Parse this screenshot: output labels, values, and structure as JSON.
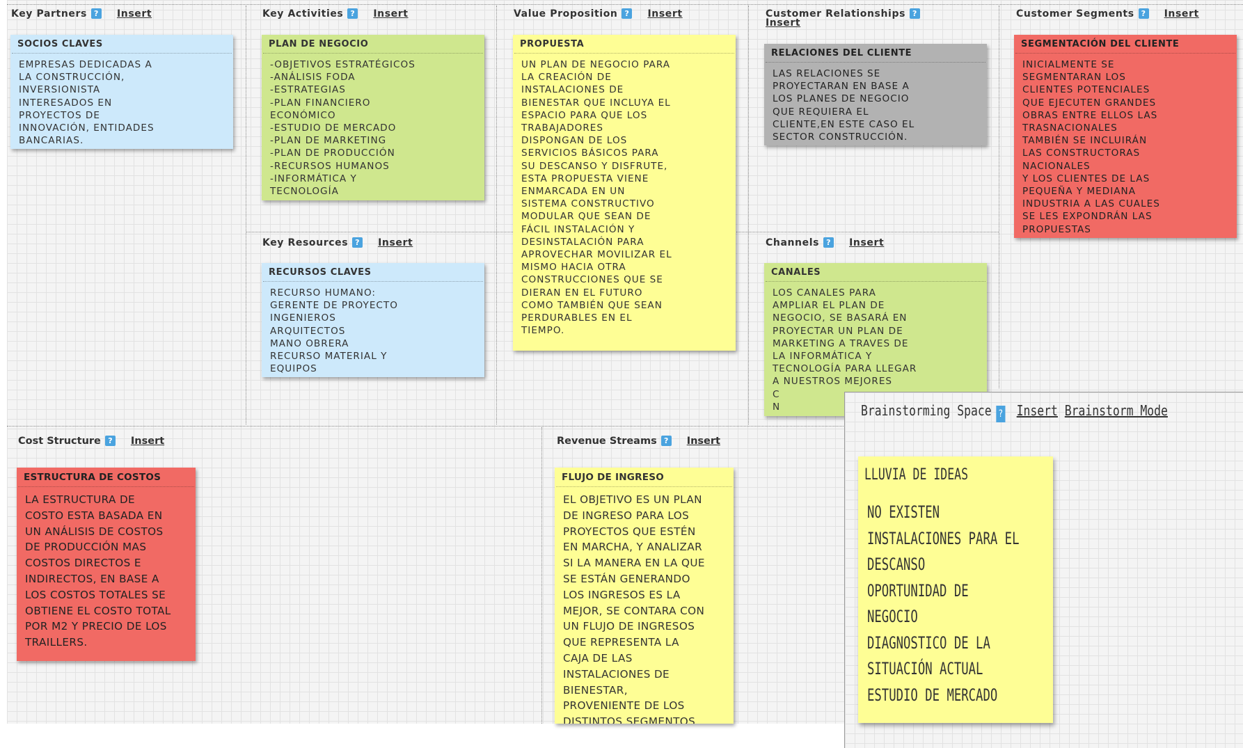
{
  "sections": {
    "key_partners": {
      "title": "Key Partners",
      "insert": "Insert"
    },
    "key_activities": {
      "title": "Key Activities",
      "insert": "Insert"
    },
    "value_proposition": {
      "title": "Value Proposition",
      "insert": "Insert"
    },
    "customer_relationships": {
      "title": "Customer Relationships",
      "insert": "Insert"
    },
    "customer_segments": {
      "title": "Customer Segments",
      "insert": "Insert"
    },
    "key_resources": {
      "title": "Key Resources",
      "insert": "Insert"
    },
    "channels": {
      "title": "Channels",
      "insert": "Insert"
    },
    "cost_structure": {
      "title": "Cost Structure",
      "insert": "Insert"
    },
    "revenue_streams": {
      "title": "Revenue Streams",
      "insert": "Insert"
    },
    "help_glyph": "?"
  },
  "notes": {
    "socios": {
      "title": "SOCIOS CLAVES",
      "body": "EMPRESAS DEDICADAS A\nLA CONSTRUCCIÓN,\nINVERSIONISTA\nINTERESADOS EN\nPROYECTOS DE\nINNOVACIÓN, ENTIDADES\nBANCARIAS."
    },
    "plan": {
      "title": "PLAN DE NEGOCIO",
      "body": "-OBJETIVOS ESTRATÉGICOS\n-ANÁLISIS FODA\n-ESTRATEGIAS\n-PLAN FINANCIERO\nECONÓMICO\n-ESTUDIO DE MERCADO\n-PLAN DE MARKETING\n-PLAN DE PRODUCCIÓN\n-RECURSOS HUMANOS\n-INFORMÁTICA Y\nTECNOLOGÍA"
    },
    "propuesta": {
      "title": "PROPUESTA",
      "body": "UN PLAN DE NEGOCIO PARA\nLA CREACIÓN DE\nINSTALACIONES DE\nBIENESTAR QUE INCLUYA EL\nESPACIO PARA QUE LOS\nTRABAJADORES\nDISPONGAN DE LOS\nSERVICIOS BÁSICOS PARA\nSU DESCANSO Y DISFRUTE,\nESTA PROPUESTA VIENE\nENMARCADA EN UN\nSISTEMA CONSTRUCTIVO\nMODULAR QUE SEAN DE\nFÁCIL INSTALACIÓN Y\nDESINSTALACIÓN PARA\nAPROVECHAR MOVILIZAR EL\nMISMO HACIA OTRA\nCONSTRUCCIONES QUE SE\nDIERAN EN EL FUTURO\nCOMO TAMBIÉN QUE SEAN\nPERDURABLES EN EL\nTIEMPO."
    },
    "relaciones": {
      "title": "RELACIONES DEL CLIENTE",
      "body": "LAS RELACIONES SE\nPROYECTARAN EN BASE A\nLOS PLANES DE NEGOCIO\nQUE REQUIERA EL\nCLIENTE,EN ESTE CASO EL\nSECTOR CONSTRUCCIÓN."
    },
    "segmentacion": {
      "title": "SEGMENTACIÓN DEL CLIENTE",
      "body": "INICIALMENTE SE\nSEGMENTARAN LOS\nCLIENTES POTENCIALES\nQUE EJECUTEN GRANDES\nOBRAS ENTRE ELLOS LAS\nTRASNACIONALES\nTAMBIÉN SE INCLUIRÁN\nLAS CONSTRUCTORAS\nNACIONALES\nY LOS CLIENTES DE LAS\nPEQUEÑA Y MEDIANA\nINDUSTRIA A LAS CUALES\nSE LES EXPONDRÁN LAS\nPROPUESTAS"
    },
    "recursos": {
      "title": "RECURSOS CLAVES",
      "body": "RECURSO HUMANO:\nGERENTE DE PROYECTO\nINGENIEROS\nARQUITECTOS\nMANO OBRERA\nRECURSO MATERIAL Y\nEQUIPOS"
    },
    "canales": {
      "title": "CANALES",
      "body": "LOS CANALES PARA\nAMPLIAR EL PLAN DE\nNEGOCIO, SE BASARÁ EN\nPROYECTAR UN PLAN DE\nMARKETING A TRAVES DE\nLA INFORMÁTICA Y\nTECNOLOGÍA PARA LLEGAR\nA NUESTROS MEJORES\nC\nN"
    },
    "costos": {
      "title": "ESTRUCTURA DE COSTOS",
      "body": "LA ESTRUCTURA DE\nCOSTO ESTA BASADA EN\nUN ANÁLISIS DE COSTOS\nDE PRODUCCIÓN MAS\nCOSTOS DIRECTOS E\nINDIRECTOS, EN BASE A\nLOS COSTOS TOTALES SE\nOBTIENE EL COSTO TOTAL\nPOR M2 Y PRECIO DE LOS\nTRAILLERS."
    },
    "flujo": {
      "title": "FLUJO DE INGRESO",
      "body": "EL OBJETIVO ES UN PLAN\nDE INGRESO PARA LOS\nPROYECTOS QUE ESTÉN\nEN MARCHA, Y ANALIZAR\nSI LA MANERA EN LA QUE\nSE ESTÁN GENERANDO\nLOS INGRESOS ES LA\nMEJOR, SE CONTARA CON\nUN FLUJO DE INGRESOS\nQUE REPRESENTA LA\nCAJA DE LAS\nINSTALACIONES DE\nBIENESTAR,\nPROVENIENTE DE LOS\nDISTINTOS SEGMENTOS"
    }
  },
  "brainstorm": {
    "title": "Brainstorming Space",
    "insert": "Insert",
    "mode": "Brainstorm Mode",
    "note_title": "LLUVIA DE IDEAS",
    "note_body": "NO EXISTEN\nINSTALACIONES PARA EL\nDESCANSO\nOPORTUNIDAD DE\nNEGOCIO\nDIAGNOSTICO DE LA\nSITUACIÓN ACTUAL\nESTUDIO DE MERCADO"
  },
  "colors": {
    "blue": "#cde9fb",
    "green": "#cfe78e",
    "yellow": "#fefe95",
    "gray": "#b2b2b2",
    "red": "#f16a64",
    "help": "#4aa3df"
  }
}
